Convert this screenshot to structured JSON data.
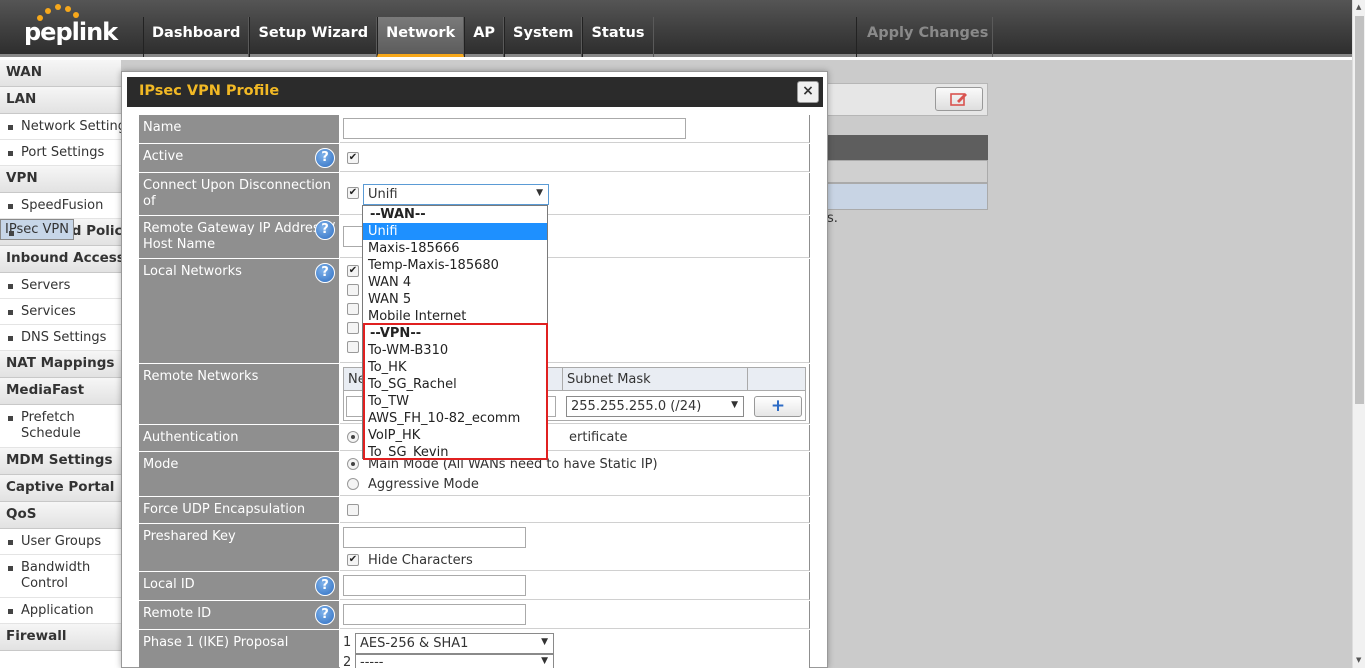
{
  "brand": {
    "logo_text": "peplink"
  },
  "nav": {
    "items": [
      "Dashboard",
      "Setup Wizard",
      "Network",
      "AP",
      "System",
      "Status"
    ],
    "active": "Network",
    "apply_label": "Apply Changes"
  },
  "sidebar": {
    "wan": "WAN",
    "lan": "LAN",
    "lan_network_settings": "Network Settings",
    "lan_port_settings": "Port Settings",
    "vpn": "VPN",
    "vpn_speedfusion": "SpeedFusion",
    "vpn_ipsec": "IPsec VPN",
    "outbound": "Outbound Policy",
    "inbound": "Inbound Access",
    "inbound_servers": "Servers",
    "inbound_services": "Services",
    "inbound_dns": "DNS Settings",
    "nat": "NAT Mappings",
    "mediafast": "MediaFast",
    "prefetch": "Prefetch Schedule",
    "mdm": "MDM Settings",
    "captive": "Captive Portal",
    "qos": "QoS",
    "qos_user_groups": "User Groups",
    "qos_bandwidth": "Bandwidth Control",
    "qos_application": "Application",
    "firewall": "Firewall"
  },
  "background": {
    "trailing_text": "s."
  },
  "dialog": {
    "title": "IPsec VPN Profile",
    "close_label": "×",
    "labels": {
      "name": "Name",
      "active": "Active",
      "connect_upon": "Connect Upon Disconnection of",
      "remote_gateway": "Remote Gateway IP Address / Host Name",
      "local_networks": "Local Networks",
      "remote_networks": "Remote Networks",
      "authentication": "Authentication",
      "mode": "Mode",
      "force_udp": "Force UDP Encapsulation",
      "preshared_key": "Preshared Key",
      "local_id": "Local ID",
      "remote_id": "Remote ID",
      "phase1": "Phase 1 (IKE) Proposal"
    },
    "connect_select_value": "Unifi",
    "remote_networks": {
      "col_network": "Ne",
      "col_subnet": "Subnet Mask",
      "subnet_value": "255.255.255.0 (/24)"
    },
    "authentication_option": "ertificate",
    "mode_options": {
      "main": "Main Mode (All WANs need to have Static IP)",
      "aggressive": "Aggressive Mode"
    },
    "hide_characters": "Hide Characters",
    "phase1": {
      "row1_num": "1",
      "row1_value": "AES-256 & SHA1",
      "row2_num": "2",
      "row2_value": "-----"
    }
  },
  "dropdown": {
    "wan_group": "--WAN--",
    "wan_options": [
      "Unifi",
      "Maxis-185666",
      "Temp-Maxis-185680",
      "WAN 4",
      "WAN 5",
      "Mobile Internet"
    ],
    "highlighted": "Unifi",
    "vpn_group": "--VPN--",
    "vpn_options": [
      "To-WM-B310",
      "To_HK",
      "To_SG_Rachel",
      "To_TW",
      "AWS_FH_10-82_ecomm",
      "VoIP_HK",
      "To_SG_Kevin"
    ]
  },
  "colors": {
    "accent": "#f7a81b",
    "title_text": "#f2b925",
    "highlight": "#1e90ff",
    "callout": "#e02020"
  }
}
